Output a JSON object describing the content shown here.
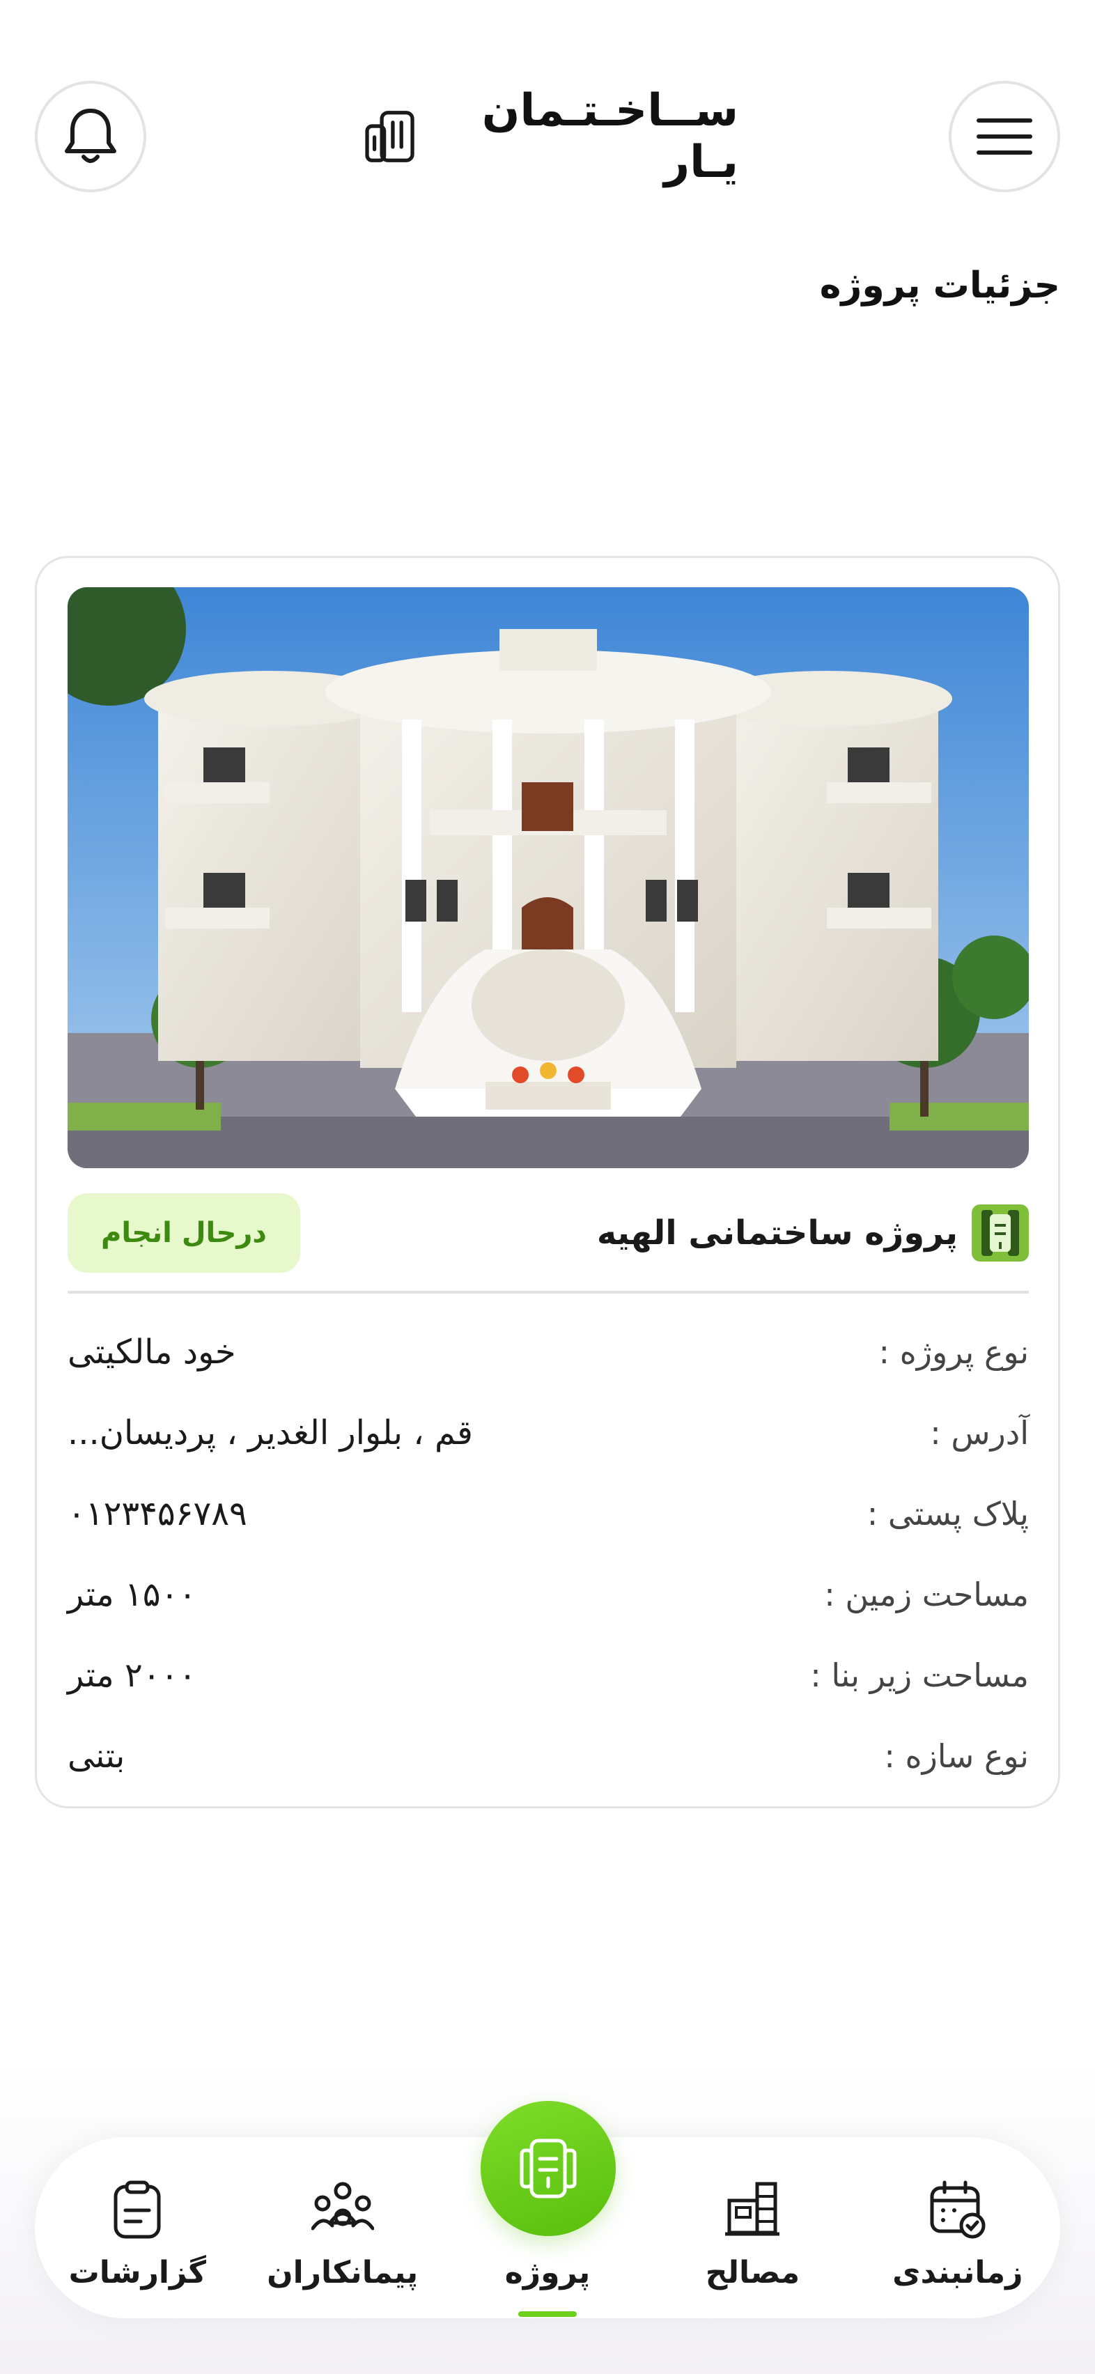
{
  "header": {
    "app_name": "ســاخـتـمان يـار",
    "page_title": "جزئیات پروژه"
  },
  "project": {
    "name": "پروژه ساختمانی الهیه",
    "status": "درحال انجام",
    "details": [
      {
        "label": "نوع پروژه :",
        "value": "خود مالکیتی"
      },
      {
        "label": "آدرس :",
        "value": "قم ، بلوار الغدیر ، پردیسان..."
      },
      {
        "label": "پلاک پستی :",
        "value": "۰۱۲۳۴۵۶۷۸۹"
      },
      {
        "label": "مساحت زمین :",
        "value": "۱۵۰۰ متر"
      },
      {
        "label": "مساحت زیر بنا :",
        "value": "۲۰۰۰ متر"
      },
      {
        "label": "نوع سازه :",
        "value": "بتنی"
      }
    ]
  },
  "nav": {
    "items": [
      {
        "label": "زمانبندی",
        "icon": "calendar-check-icon"
      },
      {
        "label": "مصالح",
        "icon": "materials-icon"
      },
      {
        "label": "پروژه",
        "icon": "project-icon",
        "active": true
      },
      {
        "label": "پیمانکاران",
        "icon": "contractors-icon"
      },
      {
        "label": "گزارشات",
        "icon": "report-clipboard-icon"
      }
    ]
  },
  "colors": {
    "accent": "#6ccf1a",
    "status_bg": "#e6f8cc",
    "status_text": "#3d8a10"
  }
}
